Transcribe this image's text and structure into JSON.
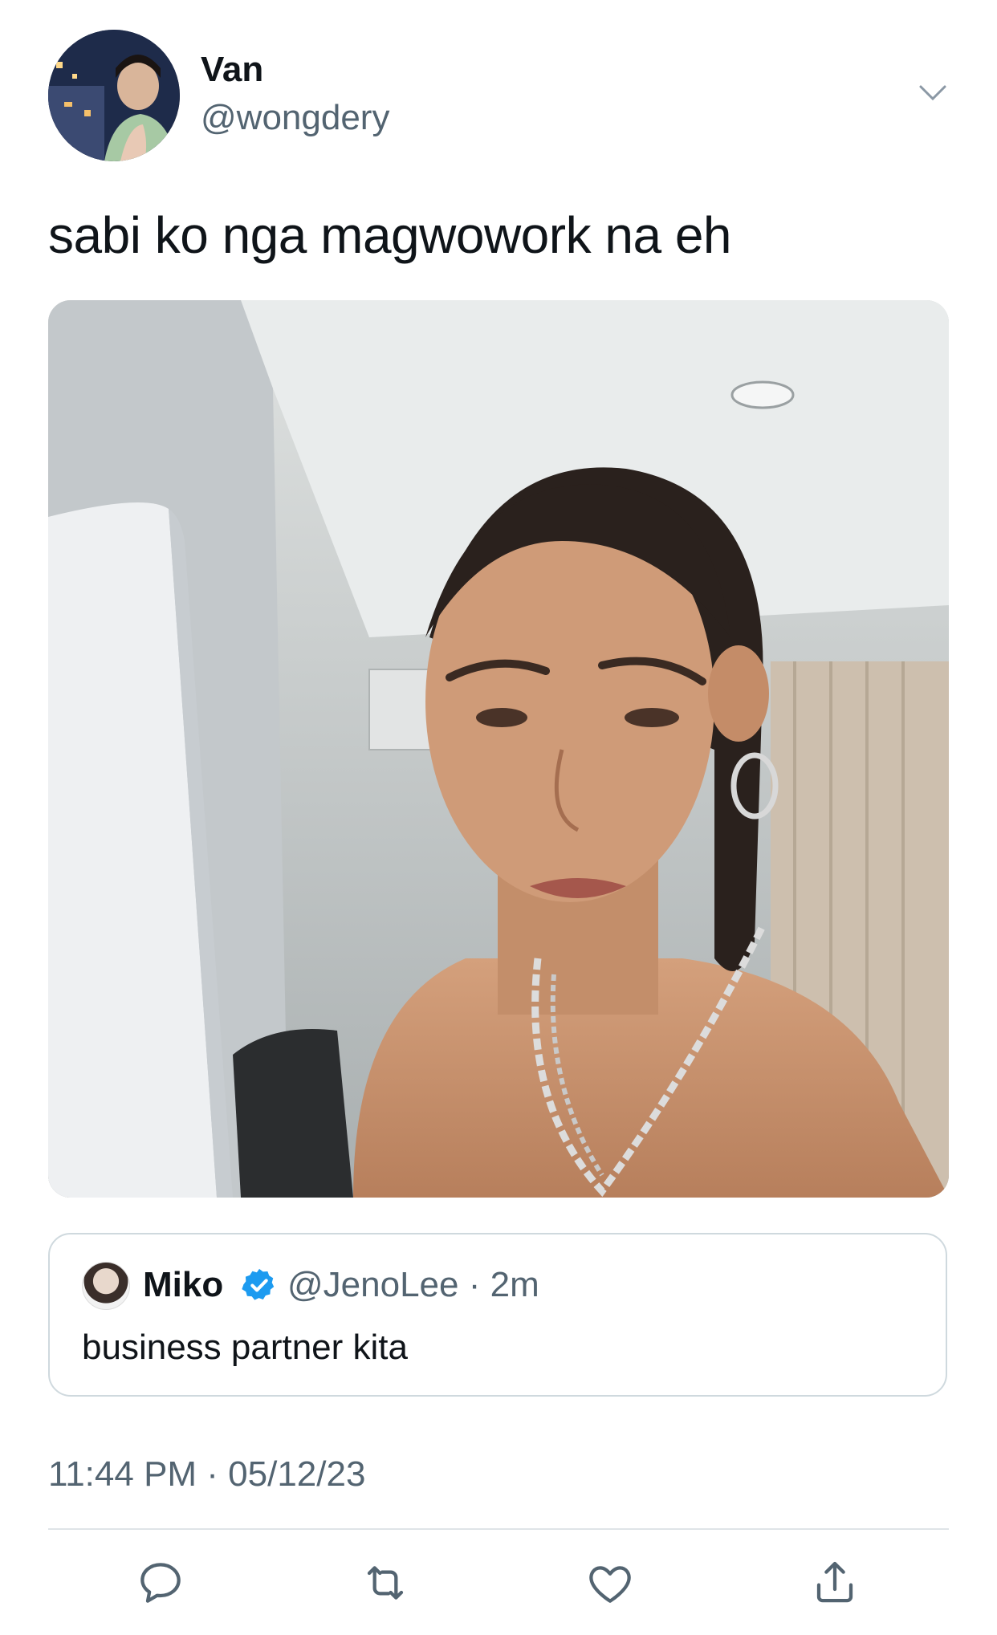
{
  "author": {
    "name": "Van",
    "handle": "@wongdery"
  },
  "tweet": {
    "text": "sabi ko nga magwowork na eh",
    "timestamp": "11:44 PM · 05/12/23"
  },
  "quoted_tweet": {
    "name": "Miko",
    "handle_time": "@JenoLee · 2m",
    "text": "business partner kita"
  },
  "icons": {
    "more": "chevron-down-icon",
    "verified": "verified-badge-icon",
    "reply": "reply-icon",
    "retweet": "retweet-icon",
    "like": "heart-icon",
    "share": "share-icon"
  },
  "colors": {
    "text": "#0f1419",
    "secondary": "#536471",
    "verified": "#1d9bf0",
    "border": "#cfd9de"
  }
}
